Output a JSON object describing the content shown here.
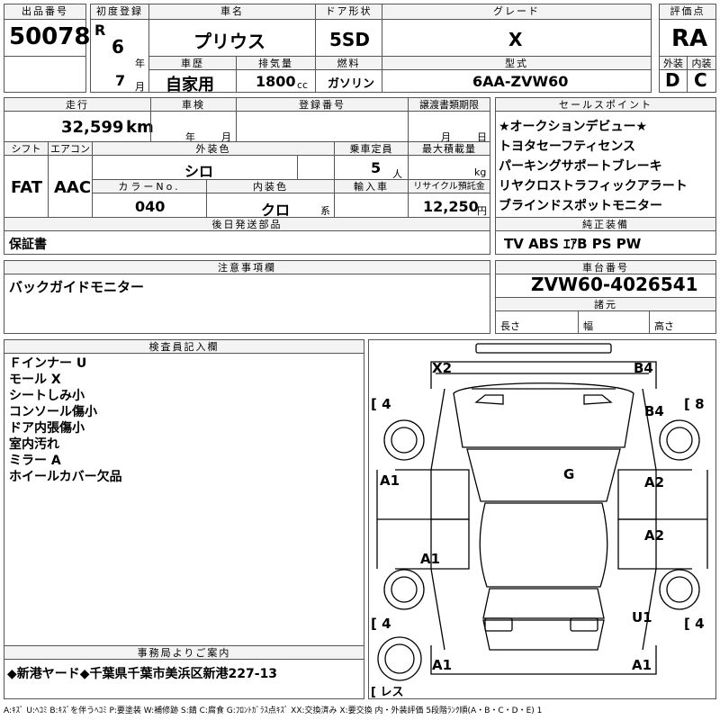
{
  "headers": {
    "lot_no": "出品番号",
    "first_reg": "初度登録",
    "car_name": "車名",
    "door": "ドア形状",
    "grade": "グレード",
    "score": "評価点",
    "history": "車歴",
    "displacement": "排気量",
    "fuel": "燃料",
    "model_code": "型式",
    "exterior": "外装",
    "interior": "内装",
    "mileage": "走行",
    "inspection": "車検",
    "reg_no": "登録番号",
    "transfer": "譲渡書類期限",
    "sales_points": "セールスポイント",
    "shift": "シフト",
    "aircon": "エアコン",
    "ext_color": "外装色",
    "capacity": "乗車定員",
    "max_load": "最大積載量",
    "color_no": "カラーNo.",
    "int_color": "内装色",
    "import": "輸入車",
    "recycle": "リサイクル預託金",
    "later_parts": "後日発送部品",
    "genuine_equip": "純正装備",
    "notes": "注意事項欄",
    "chassis": "車台番号",
    "dims": "諸元",
    "inspector": "検査員記入欄",
    "office": "事務局よりご案内"
  },
  "car": {
    "lot_no": "50078",
    "era": "R",
    "year": "6",
    "year_unit": "年",
    "month": "7",
    "month_unit": "月",
    "name": "プリウス",
    "door": "5SD",
    "grade": "X",
    "score": "RA",
    "history": "自家用",
    "displacement": "1800",
    "cc_unit": "cc",
    "fuel": "ガソリン",
    "model_code": "6AA-ZVW60",
    "ext_grade": "D",
    "int_grade": "C",
    "mileage": "32,599",
    "km_unit": "km",
    "inspection_year_unit": "年",
    "inspection_month_unit": "月",
    "transfer_month_unit": "月",
    "transfer_day_unit": "日",
    "shift": "FAT",
    "aircon": "AAC",
    "ext_color": "シロ",
    "capacity": "5",
    "capacity_unit": "人",
    "kg_unit": "kg",
    "color_no": "040",
    "int_color": "クロ",
    "int_color_suffix": "系",
    "recycle": "12,250",
    "yen_unit": "円",
    "later_parts": "保証書",
    "genuine_equip": "TV ABS ｴｱB PS PW",
    "notes": "バックガイドモニター",
    "chassis": "ZVW60-4026541",
    "dim_length": "長さ",
    "dim_width": "幅",
    "dim_height": "高さ",
    "office_note": "◆新港ヤード◆千葉県千葉市美浜区新港227-13"
  },
  "sales_points": [
    "★オークションデビュー★",
    "トヨタセーフティセンス",
    "パーキングサポートブレーキ",
    "リヤクロストラフィックアラート",
    "ブラインドスポットモニター"
  ],
  "inspector_notes": [
    "Ｆインナー U",
    "モール X",
    "シートしみ小",
    "コンソール傷小",
    "ドア内張傷小",
    "室内汚れ",
    "ミラー A",
    "ホイールカバー欠品"
  ],
  "diagram": {
    "marks": {
      "fl_corner": "X2",
      "fr_corner": "B4",
      "fr_fender": "B4",
      "windshield": "G",
      "left_front_door": "A1",
      "right_front_door": "A2",
      "right_rear_door": "A2",
      "left_rear_door": "A1",
      "rear_right": "U1",
      "rear_bumper_left": "A1",
      "rear_bumper_right": "A1"
    },
    "tires": {
      "front_left": "[ 4",
      "front_right": "[ 8",
      "rear_left": "[ 4",
      "rear_right": "[ 4",
      "spare": "[ レス"
    }
  },
  "legend": "A:ｷｽﾞ U:ﾍｺﾐ B:ｷｽﾞを伴うﾍｺﾐ P:要塗装 W:補修跡 S:錆 C:腐食 G:ﾌﾛﾝﾄｶﾞﾗｽ点ｷｽﾞ XX:交換済み X:要交換 内・外装評価 5段階ﾗﾝｸ順(A・B・C・D・E) 1"
}
